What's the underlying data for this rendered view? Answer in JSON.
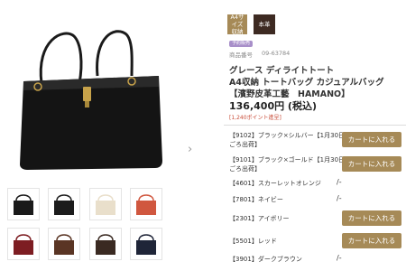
{
  "tags": {
    "a4_storage": "A4サイズ 収納",
    "genuine_leather": "本革"
  },
  "badge": "予約販売",
  "product_number_label": "商品番号",
  "product_number": "09-63784",
  "title_lines": [
    "グレース ディライトトート",
    "A4収納 トートバッグ カジュアルバッグ",
    "【濱野皮革工藝　HAMANO】"
  ],
  "price": "136,400円 (税込)",
  "points": "[1,240ポイント進呈]",
  "variants": [
    {
      "label": "【9102】ブラック×シルバー【1月30日",
      "label2": "ごろ出荷】",
      "button": "カートに入れる"
    },
    {
      "label": "【9101】ブラック×ゴールド【1月30日",
      "label2": "ごろ出荷】",
      "button": "カートに入れる"
    },
    {
      "label": "【4601】スカーレットオレンジ",
      "availability": "/-"
    },
    {
      "label": "【7801】ネイビー",
      "availability": "/-"
    },
    {
      "label": "【2301】アイボリー",
      "button": "カートに入れる"
    },
    {
      "label": "【5501】レッド",
      "button": "カートに入れる"
    },
    {
      "label": "【3901】ダークブラウン",
      "availability": "/-"
    }
  ],
  "colors": {
    "accent_gold": "#a68a57",
    "leather_tag": "#3d2a22",
    "points_red": "#c94c38",
    "badge_purple": "#a88fc9"
  },
  "thumbnails": [
    {
      "name": "thumb-black-silver",
      "color": "#1a1a1a"
    },
    {
      "name": "thumb-black-gold",
      "color": "#1c1c1c"
    },
    {
      "name": "thumb-ivory",
      "color": "#e9dfcb"
    },
    {
      "name": "thumb-orange",
      "color": "#d0573f"
    },
    {
      "name": "thumb-red",
      "color": "#7d1d22"
    },
    {
      "name": "thumb-brown",
      "color": "#5a3524"
    },
    {
      "name": "thumb-dark-brown",
      "color": "#3a2a22"
    },
    {
      "name": "thumb-navy",
      "color": "#1f2538"
    }
  ]
}
